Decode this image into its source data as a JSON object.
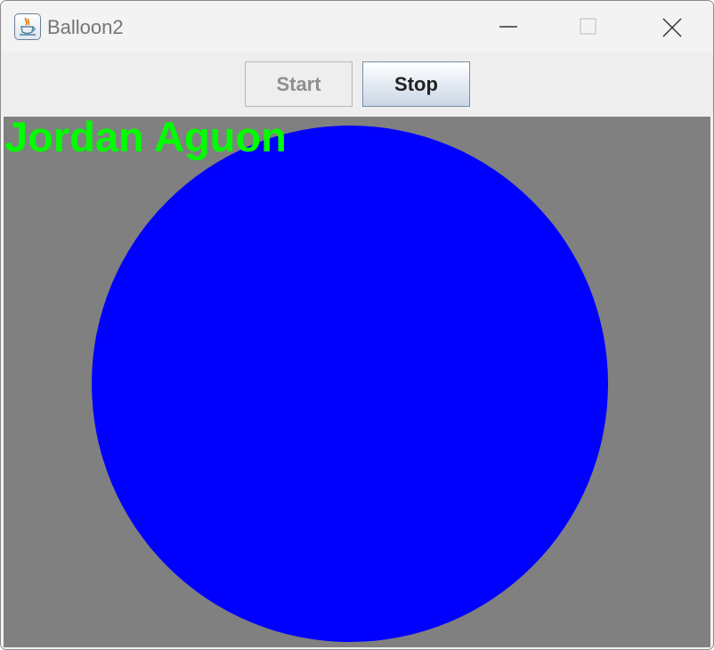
{
  "window": {
    "title": "Balloon2",
    "app_icon": "java-cup-icon",
    "controls": [
      "minimize-icon",
      "maximize-icon",
      "close-icon"
    ]
  },
  "toolbar": {
    "start_label": "Start",
    "stop_label": "Stop",
    "start_enabled": false
  },
  "canvas": {
    "background": "#808080",
    "name_label": "Jordan Aguon",
    "name_color": "#00ff00",
    "balloon_color": "#0000ff"
  }
}
